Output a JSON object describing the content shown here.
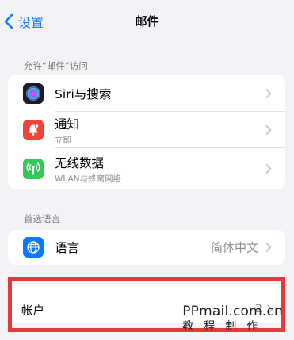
{
  "nav": {
    "back_label": "设置",
    "title": "邮件"
  },
  "allow_section": {
    "header": "允许“邮件”访问",
    "items": [
      {
        "title": "Siri与搜索",
        "subtitle": ""
      },
      {
        "title": "通知",
        "subtitle": "立即"
      },
      {
        "title": "无线数据",
        "subtitle": "WLAN与蜂窝网络"
      }
    ]
  },
  "lang_section": {
    "header": "首选语言",
    "item": {
      "title": "语言",
      "value": "简体中文"
    }
  },
  "accounts": {
    "label": "帐户",
    "count": "2"
  },
  "watermark": {
    "site": "PPmail.com.cn",
    "caption": "教程制作"
  },
  "colors": {
    "accent": "#0a7aff",
    "notification": "#f04438",
    "wireless": "#34c759",
    "language": "#0a7aff",
    "highlight": "#e53a3a"
  }
}
